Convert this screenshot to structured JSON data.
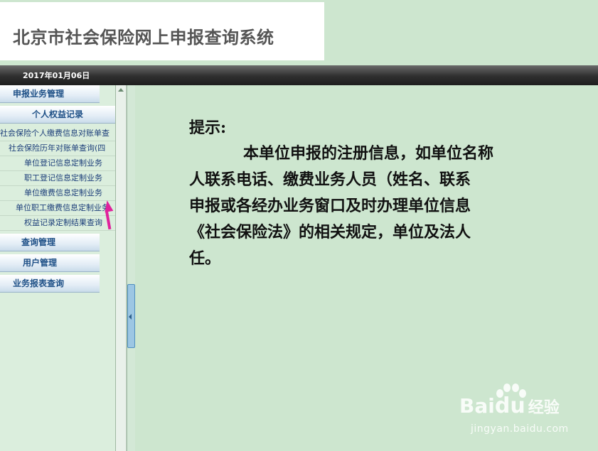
{
  "header": {
    "title": "北京市社会保险网上申报查询系统"
  },
  "datebar": {
    "date": "2017年01月06日"
  },
  "sidebar": {
    "menus": [
      {
        "label": "申报业务管理"
      },
      {
        "label": "个人权益记录",
        "items": [
          "社会保险个人缴费信息对账单查",
          "社会保险历年对账单查询(四",
          "单位登记信息定制业务",
          "职工登记信息定制业务",
          "单位缴费信息定制业务",
          "单位职工缴费信息定制业务",
          "权益记录定制结果查询"
        ]
      },
      {
        "label": "查询管理"
      },
      {
        "label": "用户管理"
      },
      {
        "label": "业务报表查询"
      }
    ]
  },
  "main": {
    "label": "提示:",
    "lines": [
      "本单位申报的注册信息，如单位名称",
      "人联系电话、缴费业务人员（姓名、联系",
      "申报或各经办业务窗口及时办理单位信息",
      "《社会保险法》的相关规定，单位及法人",
      "任。"
    ]
  },
  "watermark": {
    "brand": "Bai",
    "brand2": "经验",
    "url": "jingyan.baidu.com"
  },
  "colors": {
    "background": "#cde6cf",
    "menu_text": "#1d4f86",
    "cursor": "#e0219c"
  }
}
